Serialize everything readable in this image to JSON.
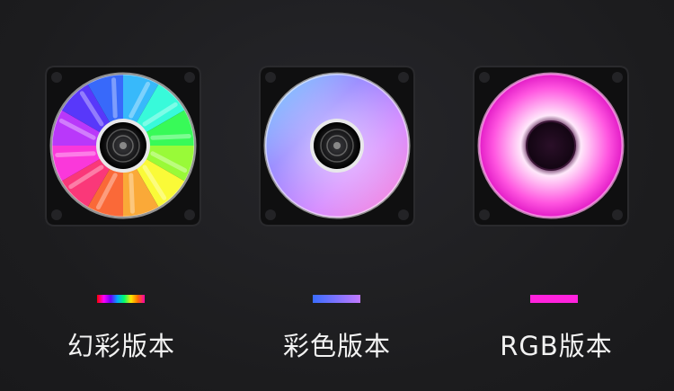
{
  "variants": [
    {
      "label": "幻彩版本",
      "swatch_colors": [
        "#ff0000",
        "#ff00ff",
        "#6a00ff",
        "#00a8ff",
        "#00ff6a",
        "#ffe600",
        "#ff6a00",
        "#ff00aa"
      ]
    },
    {
      "label": "彩色版本",
      "swatch_colors": [
        "#3a6cff",
        "#c27aff"
      ]
    },
    {
      "label": "RGB版本",
      "swatch_colors": [
        "#ff22dd"
      ]
    }
  ],
  "colors": {
    "background": "#1f1f21",
    "label_text": "#f2f2f2",
    "fan_frame": "#0f0f10"
  }
}
